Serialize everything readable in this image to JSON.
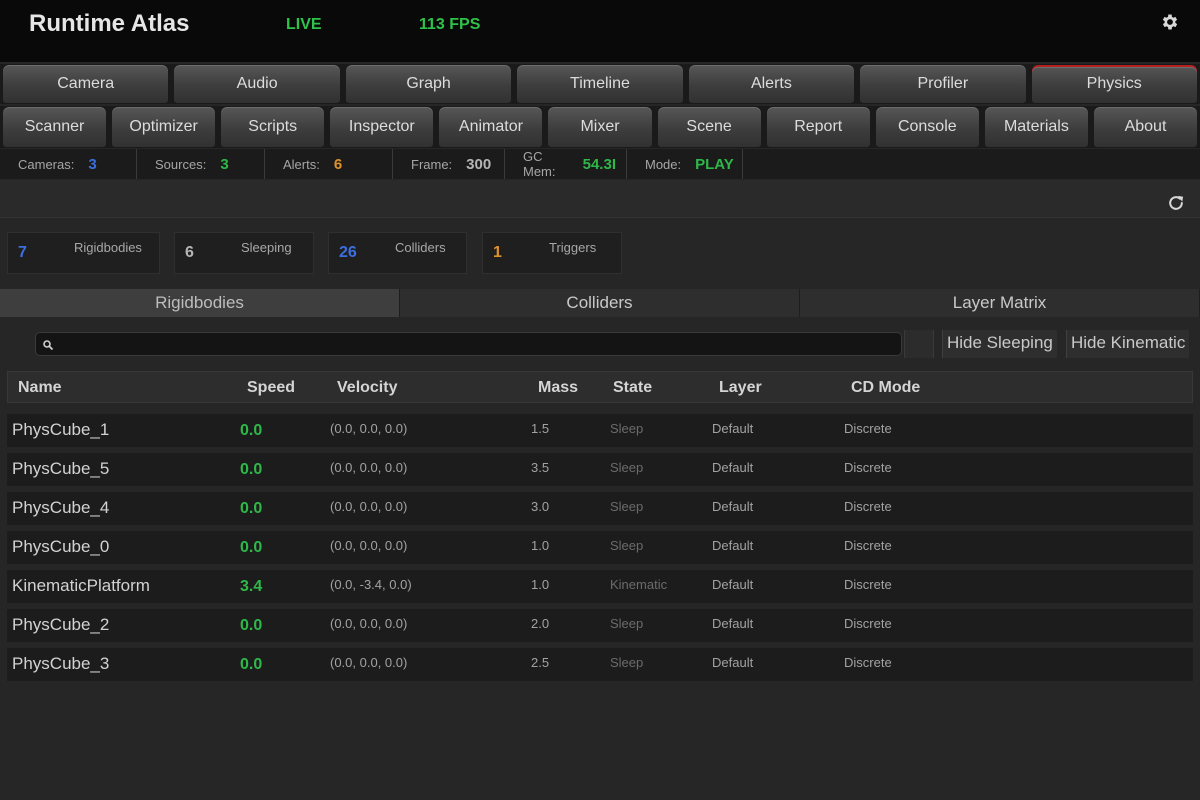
{
  "header": {
    "title": "Runtime Atlas",
    "live": "LIVE",
    "fps": "113 FPS",
    "settings_icon": "gear-icon"
  },
  "tabs_row1": [
    "Camera",
    "Audio",
    "Graph",
    "Timeline",
    "Alerts",
    "Profiler",
    "Physics"
  ],
  "tabs_row2": [
    "Scanner",
    "Optimizer",
    "Scripts",
    "Inspector",
    "Animator",
    "Mixer",
    "Scene",
    "Report",
    "Console",
    "Materials",
    "About"
  ],
  "active_tab": "Physics",
  "stats": [
    {
      "label": "Cameras:",
      "value": "3",
      "color": "#3b6fe0"
    },
    {
      "label": "Sources:",
      "value": "3",
      "color": "#2fb84a"
    },
    {
      "label": "Alerts:",
      "value": "6",
      "color": "#e0922a"
    },
    {
      "label": "Frame:",
      "value": "300",
      "color": "#b5b5b5"
    },
    {
      "label": "GC Mem:",
      "value": "54.3I",
      "color": "#2fb84a"
    },
    {
      "label": "Mode:",
      "value": "PLAY",
      "color": "#2fb84a"
    }
  ],
  "refresh_icon": "refresh-icon",
  "summary_cards": [
    {
      "count": "7",
      "label": "Rigidbodies",
      "color": "#3b6fe0"
    },
    {
      "count": "6",
      "label": "Sleeping",
      "color": "#b5b5b5"
    },
    {
      "count": "26",
      "label": "Colliders",
      "color": "#3b6fe0"
    },
    {
      "count": "1",
      "label": "Triggers",
      "color": "#e0922a"
    }
  ],
  "subtabs": [
    "Rigidbodies",
    "Colliders",
    "Layer Matrix"
  ],
  "active_subtab": "Rigidbodies",
  "search": {
    "value": "",
    "placeholder": ""
  },
  "filters": {
    "hide_sleeping": "Hide Sleeping",
    "hide_kinematic": "Hide Kinematic"
  },
  "table": {
    "columns": [
      "Name",
      "Speed",
      "Velocity",
      "Mass",
      "State",
      "Layer",
      "CD Mode"
    ],
    "rows": [
      {
        "name": "PhysCube_1",
        "speed": "0.0",
        "velocity": "(0.0, 0.0, 0.0)",
        "mass": "1.5",
        "state": "Sleep",
        "layer": "Default",
        "cd": "Discrete"
      },
      {
        "name": "PhysCube_5",
        "speed": "0.0",
        "velocity": "(0.0, 0.0, 0.0)",
        "mass": "3.5",
        "state": "Sleep",
        "layer": "Default",
        "cd": "Discrete"
      },
      {
        "name": "PhysCube_4",
        "speed": "0.0",
        "velocity": "(0.0, 0.0, 0.0)",
        "mass": "3.0",
        "state": "Sleep",
        "layer": "Default",
        "cd": "Discrete"
      },
      {
        "name": "PhysCube_0",
        "speed": "0.0",
        "velocity": "(0.0, 0.0, 0.0)",
        "mass": "1.0",
        "state": "Sleep",
        "layer": "Default",
        "cd": "Discrete"
      },
      {
        "name": "KinematicPlatform",
        "speed": "3.4",
        "velocity": "(0.0, -3.4, 0.0)",
        "mass": "1.0",
        "state": "Kinematic",
        "layer": "Default",
        "cd": "Discrete"
      },
      {
        "name": "PhysCube_2",
        "speed": "0.0",
        "velocity": "(0.0, 0.0, 0.0)",
        "mass": "2.0",
        "state": "Sleep",
        "layer": "Default",
        "cd": "Discrete"
      },
      {
        "name": "PhysCube_3",
        "speed": "0.0",
        "velocity": "(0.0, 0.0, 0.0)",
        "mass": "2.5",
        "state": "Sleep",
        "layer": "Default",
        "cd": "Discrete"
      }
    ]
  }
}
